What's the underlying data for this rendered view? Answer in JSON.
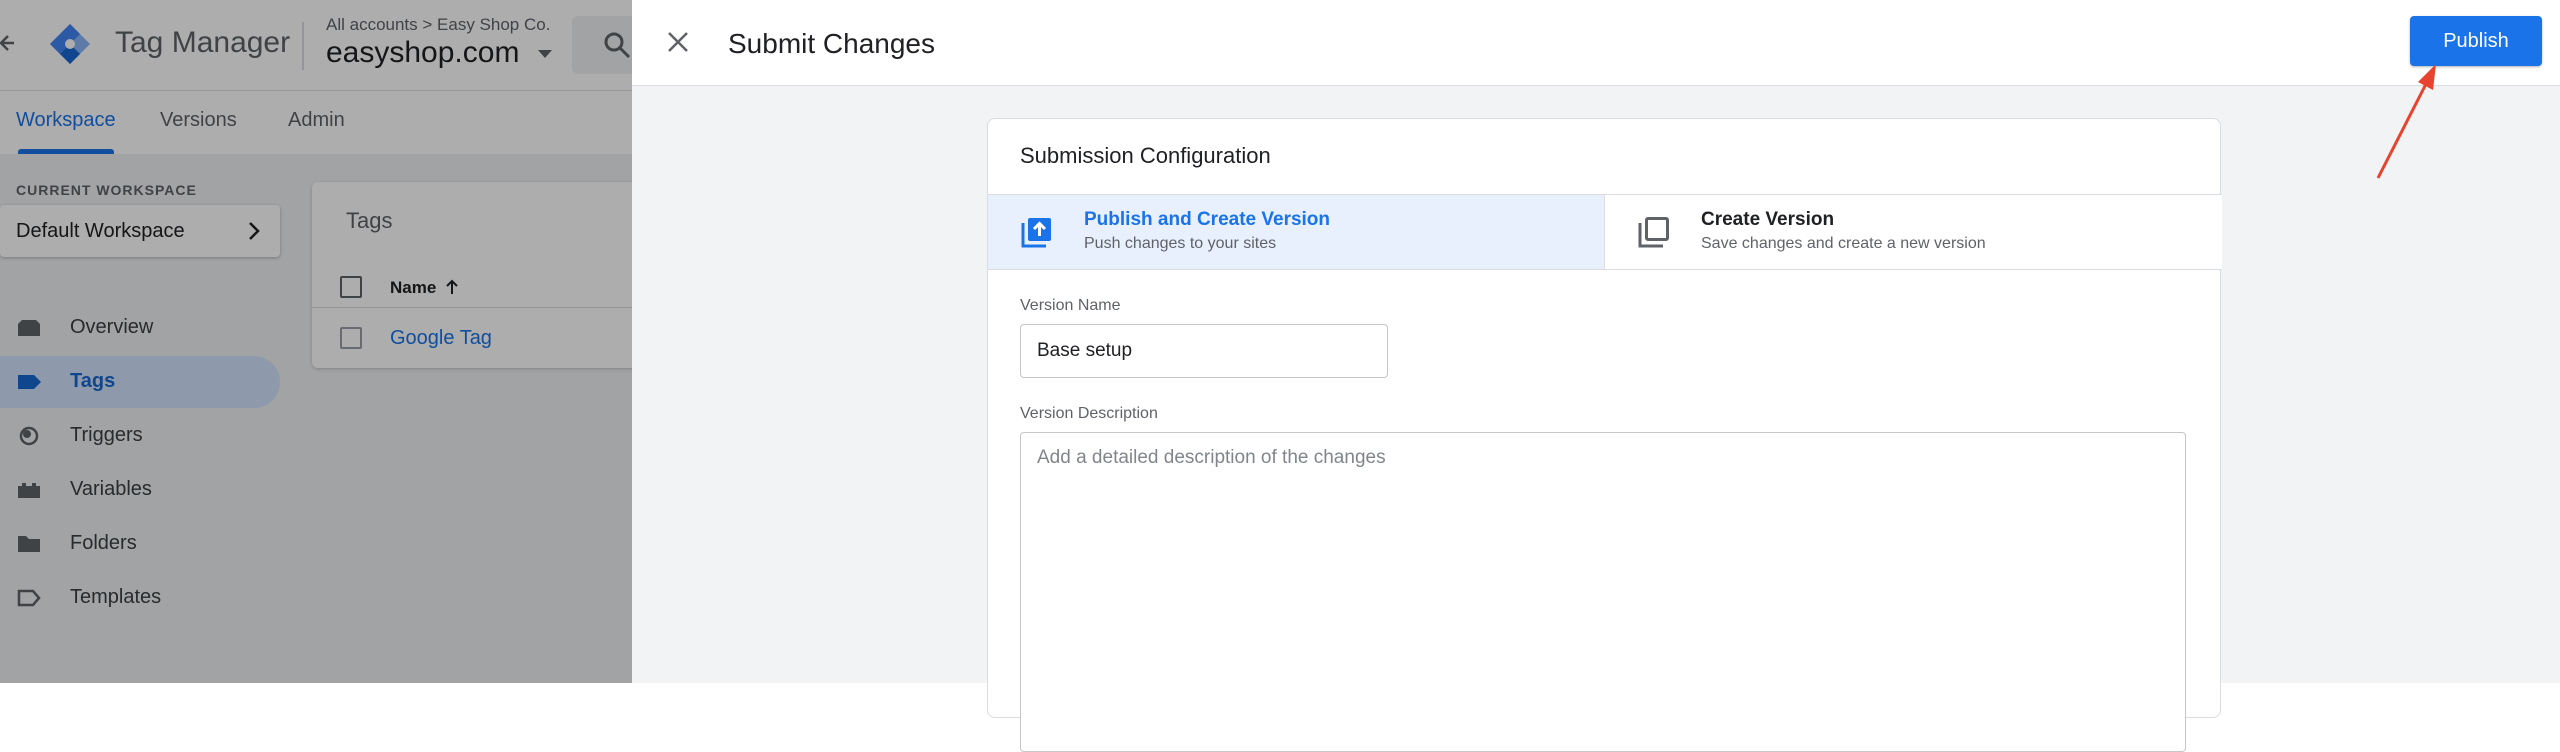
{
  "app": {
    "product_name": "Tag Manager",
    "breadcrumb": "All accounts > Easy Shop Co.",
    "container": "easyshop.com",
    "nav_tabs": [
      {
        "label": "Workspace",
        "active": true
      },
      {
        "label": "Versions",
        "active": false
      },
      {
        "label": "Admin",
        "active": false
      }
    ],
    "current_workspace_label": "CURRENT WORKSPACE",
    "workspace_name": "Default Workspace",
    "sidebar": [
      {
        "label": "Overview",
        "icon": "overview-icon",
        "active": false
      },
      {
        "label": "Tags",
        "icon": "tag-icon",
        "active": true
      },
      {
        "label": "Triggers",
        "icon": "trigger-icon",
        "active": false
      },
      {
        "label": "Variables",
        "icon": "variables-icon",
        "active": false
      },
      {
        "label": "Folders",
        "icon": "folder-icon",
        "active": false
      },
      {
        "label": "Templates",
        "icon": "template-icon",
        "active": false
      }
    ],
    "tags_panel": {
      "title": "Tags",
      "column_name": "Name",
      "rows": [
        "Google Tag"
      ]
    }
  },
  "sheet": {
    "title": "Submit Changes",
    "publish_label": "Publish",
    "config_title": "Submission Configuration",
    "options": [
      {
        "title": "Publish and Create Version",
        "subtitle": "Push changes to your sites",
        "selected": true
      },
      {
        "title": "Create Version",
        "subtitle": "Save changes and create a new version",
        "selected": false
      }
    ],
    "version_name_label": "Version Name",
    "version_name_value": "Base setup",
    "version_description_label": "Version Description",
    "version_description_placeholder": "Add a detailed description of the changes"
  },
  "colors": {
    "accent": "#1a73e8",
    "selected_option_bg": "#e8f0fe",
    "annotation_arrow": "#e8432e"
  }
}
